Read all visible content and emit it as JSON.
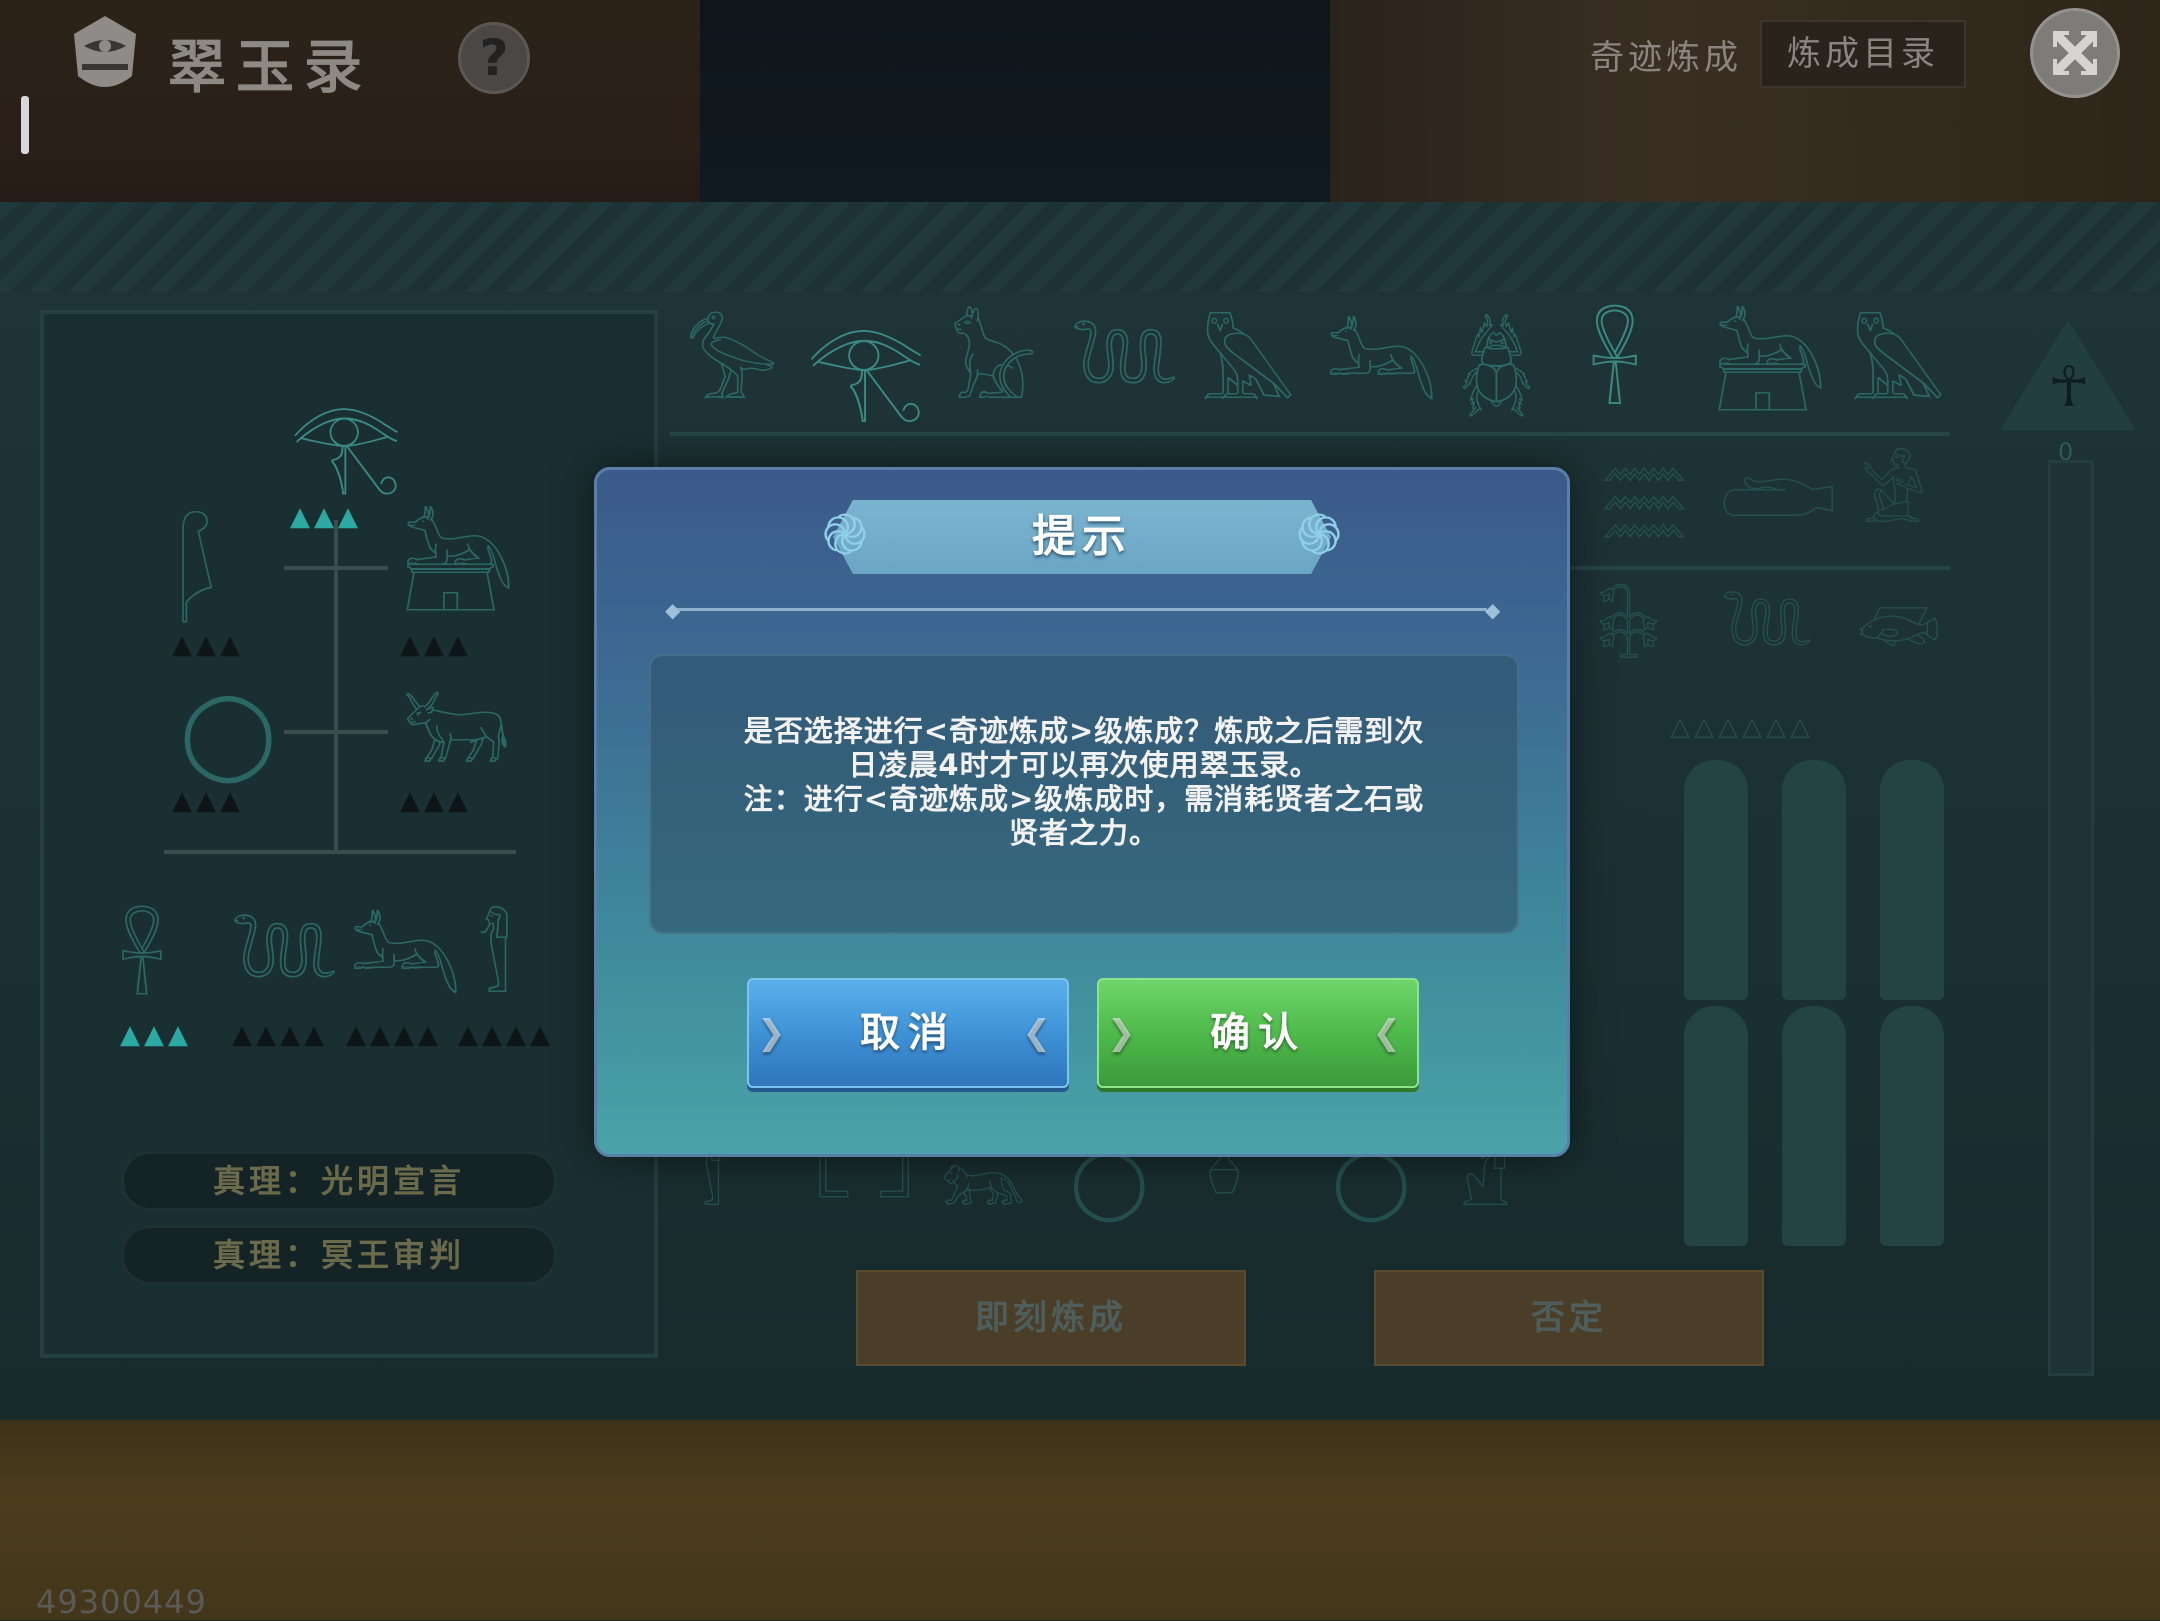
{
  "header": {
    "app_title": "翠玉录",
    "help_label": "?",
    "tab_miracle": "奇迹炼成",
    "tab_catalog": "炼成目录",
    "close_label": "✕"
  },
  "left_panel": {
    "truth_items": [
      "真理：光明宣言",
      "真理：冥王审判"
    ]
  },
  "side_rail": {
    "counter": "0"
  },
  "actions": {
    "instant_label": "即刻炼成",
    "deny_label": "否定"
  },
  "footer": {
    "id_text": "49300449"
  },
  "dialog": {
    "title": "提示",
    "message_lines": [
      "是否选择进行<奇迹炼成>级炼成？炼成之后需到次",
      "日凌晨4时才可以再次使用翠玉录。",
      "注：进行<奇迹炼成>级炼成时，需消耗贤者之石或",
      "贤者之力。"
    ],
    "cancel_label": "取消",
    "confirm_label": "确认"
  },
  "colors": {
    "dialog_top": "#3b5a8a",
    "dialog_bottom": "#4aa3a8",
    "cancel_blue": "#3d8fd4",
    "confirm_green": "#4cb749",
    "glyph_teal": "#2b6865"
  }
}
